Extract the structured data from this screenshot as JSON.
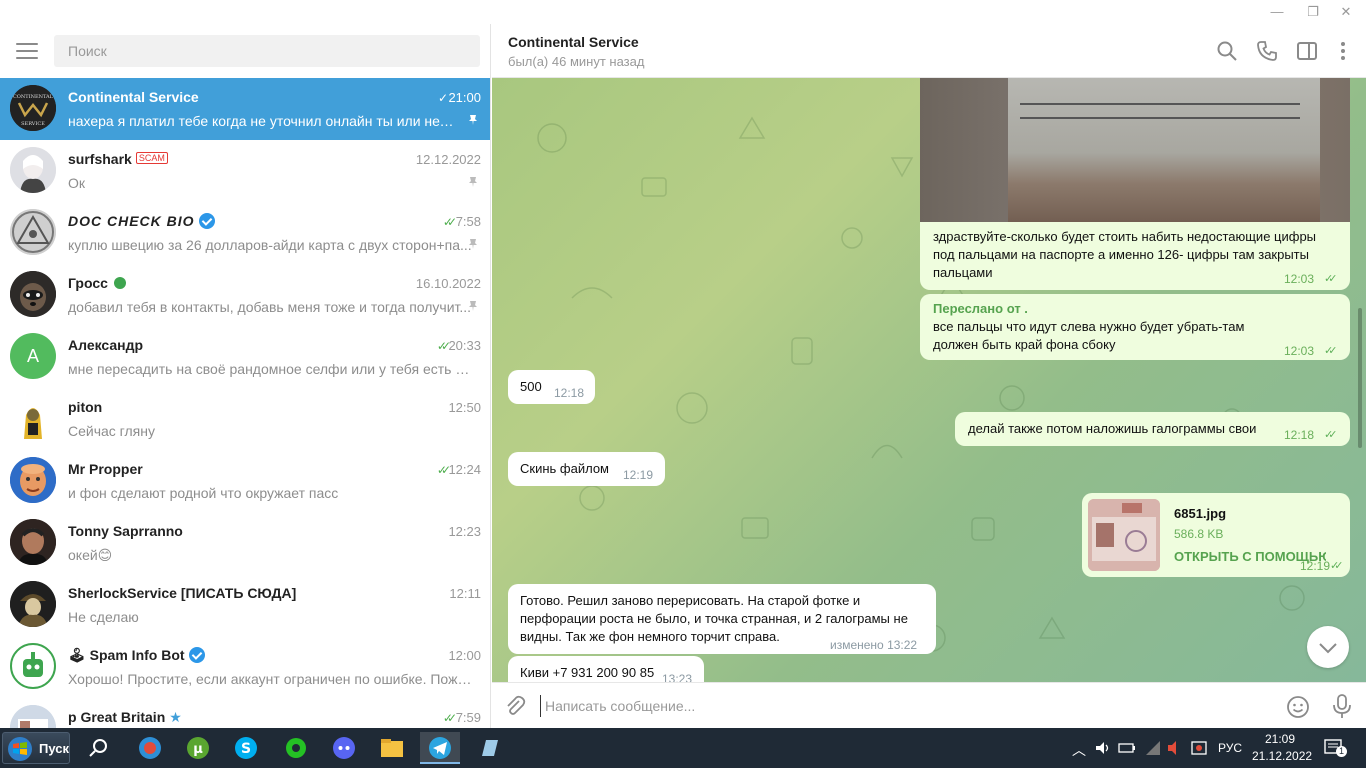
{
  "search": {
    "placeholder": "Поиск"
  },
  "chats": [
    {
      "name": "Continental Service",
      "time": "21:00",
      "preview": "нахера я платил тебе когда не уточнил онлайн ты или нет-вп..."
    },
    {
      "name": "surfshark",
      "badge": "SCAM",
      "time": "12.12.2022",
      "preview": "Ок"
    },
    {
      "name": "DOC CHECK BIO",
      "time": "7:58",
      "preview": "куплю швецию за 26 долларов-айди карта  с двух сторон+па..."
    },
    {
      "name": "Гросс",
      "time": "16.10.2022",
      "preview": "добавил тебя в контакты, добавь меня тоже и тогда получит..."
    },
    {
      "name": "Александр",
      "avatar_letter": "А",
      "time": "20:33",
      "preview": "мне пересадить на своё рандомное селфи или у тебя есть селфи ..."
    },
    {
      "name": "piton",
      "time": "12:50",
      "preview": "Сейчас гляну"
    },
    {
      "name": "Mr Propper",
      "time": "12:24",
      "preview": "и фон сделают родной что окружает пасс"
    },
    {
      "name": "Tonny Saprranno",
      "time": "12:23",
      "preview": "окей😊"
    },
    {
      "name": "SherlockService [ПИСАТЬ СЮДА]",
      "time": "12:11",
      "preview": "Не сделаю"
    },
    {
      "name": "Spam Info Bot",
      "time": "12:00",
      "preview": "Хорошо! Простите, если аккаунт ограничен по ошибке. Пожалу..."
    },
    {
      "name": "p Great Britain",
      "time": "7:59",
      "preview": ""
    }
  ],
  "header": {
    "title": "Continental Service",
    "status": "был(а) 46 минут назад"
  },
  "messages": {
    "m1": {
      "text": "здраствуйте-сколько будет стоить набить недостающие цифры под пальцами на паспорте а именно 126- цифры там закрыты пальцами",
      "time": "12:03"
    },
    "m2": {
      "forwarded": "Переслано от .",
      "text": "все пальцы что идут слева нужно будет убрать-там должен быть край фона сбоку",
      "time": "12:03"
    },
    "m3": {
      "text": "500",
      "time": "12:18"
    },
    "m4": {
      "text": "делай также потом наложишь галограммы свои",
      "time": "12:18"
    },
    "m5": {
      "text": "Скинь файлом",
      "time": "12:19"
    },
    "m6": {
      "filename": "6851.jpg",
      "size": "586.8 KB",
      "action": "ОТКРЫТЬ С ПОМОЩЬЮ",
      "time": "12:19"
    },
    "m7": {
      "text": "Готово. Решил заново перерисовать. На старой фотке и перфорации роста не было, и точка странная, и 2 галограмы не видны. Так же фон немного торчит справа.",
      "time": "изменено 13:22"
    },
    "m8": {
      "text": "Киви +7 931 200 90 85",
      "time": "13:23"
    }
  },
  "composer": {
    "placeholder": "Написать сообщение..."
  },
  "taskbar": {
    "start_label": "Пуск",
    "lang": "РУС",
    "clock_time": "21:09",
    "clock_date": "21.12.2022",
    "notif_count": "1"
  },
  "colors": {
    "active_chat": "#419fd9",
    "outgoing_bubble": "#effdde",
    "check_green": "#4fae4e"
  }
}
